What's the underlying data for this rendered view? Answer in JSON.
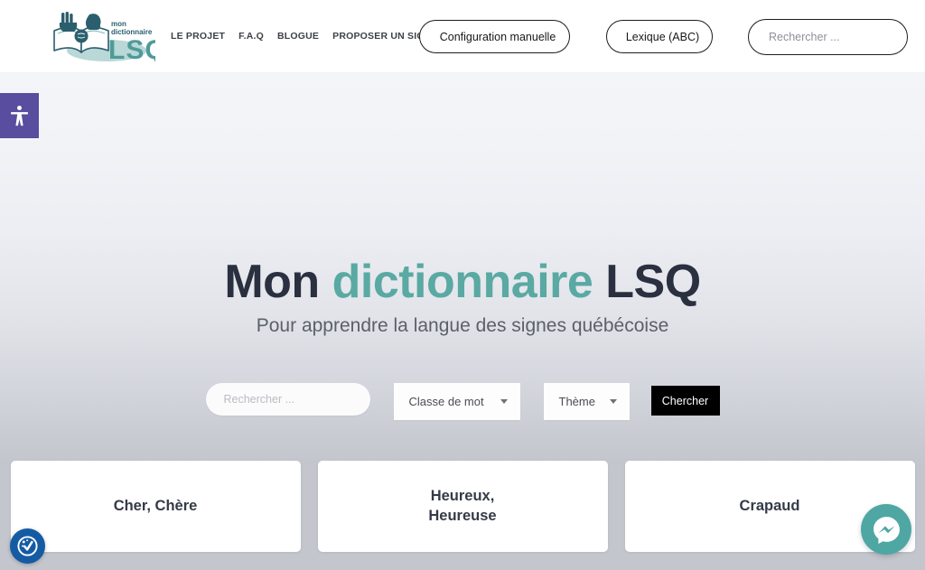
{
  "header": {
    "logo": {
      "small_line1": "mon",
      "small_line2": "dictionnaire",
      "big_text": "LSQ",
      "alt": "Mon dictionnaire LSQ"
    },
    "nav": [
      {
        "label": "LE PROJET"
      },
      {
        "label": "F.A.Q"
      },
      {
        "label": "BLOGUE"
      },
      {
        "label": "PROPOSER UN SIGNE"
      }
    ],
    "buttons": [
      {
        "label": "Configuration manuelle",
        "icon": "hand-icon"
      },
      {
        "label": "Lexique (ABC)",
        "icon": "book-icon"
      }
    ],
    "search": {
      "placeholder": "Rechercher ...",
      "value": "",
      "icon": "search-icon"
    }
  },
  "hero": {
    "title_part1": "Mon ",
    "title_accent": "dictionnaire",
    "title_part2": " LSQ",
    "subtitle": "Pour apprendre la langue des signes québécoise"
  },
  "search_form": {
    "text_input": {
      "placeholder": "Rechercher ...",
      "value": ""
    },
    "select_word_class": {
      "label": "Classe de mot",
      "icon": "chevron-down-icon"
    },
    "select_theme": {
      "label": "Thème",
      "icon": "chevron-down-icon"
    },
    "submit": {
      "label": "Chercher"
    }
  },
  "cards": [
    {
      "title": "Cher, Chère"
    },
    {
      "title": "Heureux,\nHeureuse"
    },
    {
      "title": "Crapaud"
    }
  ],
  "widgets": {
    "accessibility": {
      "icon": "accessibility-icon",
      "color": "#584d9e"
    },
    "cookie_consent": {
      "icon": "cookie-check-icon",
      "color": "#155ba4"
    },
    "messenger": {
      "icon": "messenger-icon",
      "color": "#4fa7a4"
    }
  },
  "colors": {
    "accent_teal": "#5aa9a3",
    "title_navy": "#2a3040",
    "submit_black": "#000000",
    "card_bg": "#ffffff",
    "strip_gray": "#c4c6ce"
  }
}
